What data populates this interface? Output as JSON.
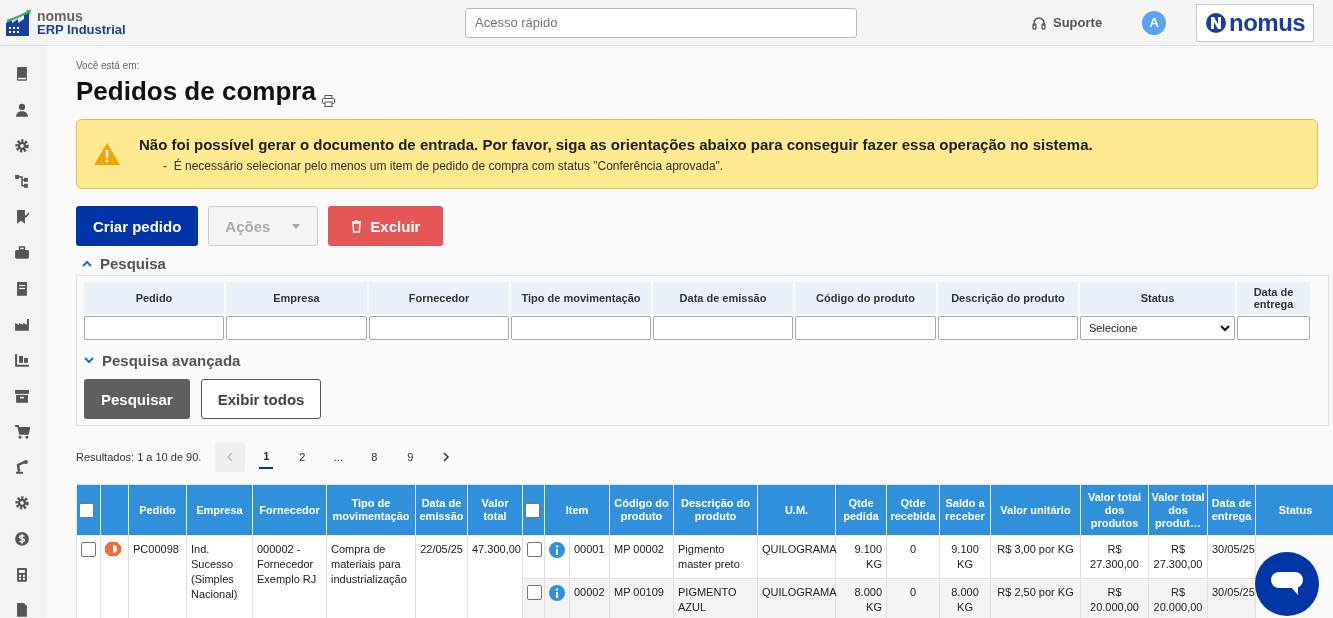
{
  "header": {
    "logo_line1": "nomus",
    "logo_line2": "ERP Industrial",
    "search": {
      "placeholder": "Acesso rápido"
    },
    "support": "Suporte",
    "avatar": "A",
    "brand": "nomus"
  },
  "breadcrumb": "Você está em:",
  "title": "Pedidos de compra",
  "alert": {
    "title": "Não foi possível gerar o documento de entrada. Por favor, siga as orientações abaixo para conseguir fazer essa operação no sistema.",
    "items": [
      {
        "bullet": "-",
        "text": "É necessário selecionar pelo menos um item de pedido de compra com status \"Conferência aprovada\"."
      }
    ]
  },
  "actions": [
    {
      "label": "Criar pedido",
      "kind": "primary",
      "disabled": false
    },
    {
      "label": "Ações",
      "kind": "dropdown",
      "disabled": true
    },
    {
      "label": "Excluir",
      "kind": "danger",
      "disabled": false
    }
  ],
  "search": {
    "title": "Pesquisa",
    "expanded": true,
    "fields": [
      {
        "label": "Pedido",
        "kind": "text"
      },
      {
        "label": "Empresa",
        "kind": "text"
      },
      {
        "label": "Fornecedor",
        "kind": "text"
      },
      {
        "label": "Tipo de movimentação",
        "kind": "text"
      },
      {
        "label": "Data de emissão",
        "kind": "text"
      },
      {
        "label": "Código do produto",
        "kind": "text"
      },
      {
        "label": "Descrição do produto",
        "kind": "text"
      },
      {
        "label": "Status",
        "kind": "select",
        "value": "Selecione"
      },
      {
        "label": "Data de entrega",
        "kind": "text"
      }
    ],
    "advanced": {
      "title": "Pesquisa avançada",
      "expanded": false
    },
    "buttons": [
      {
        "label": "Pesquisar",
        "kind": "primary"
      },
      {
        "label": "Exibir todos",
        "kind": "outline"
      }
    ]
  },
  "results": {
    "summary": "Resultados: 1 a 10 de 90.",
    "pages": [
      {
        "label": "1",
        "selected": true
      },
      {
        "label": "2",
        "selected": false
      },
      {
        "label": "...",
        "selected": false
      },
      {
        "label": "8",
        "selected": false
      },
      {
        "label": "9",
        "selected": false
      }
    ]
  },
  "table": {
    "all_orders_checked": false,
    "all_items_checked": false,
    "order_columns": [
      "Pedido",
      "Empresa",
      "Fornecedor",
      "Tipo de movimentação",
      "Data de emissão",
      "Valor total"
    ],
    "item_columns": [
      "Item",
      "Código do produto",
      "Descrição do produto",
      "U.M.",
      "Qtde pedida",
      "Qtde recebida",
      "Saldo a receber",
      "Valor unitário",
      "Valor total dos produtos",
      "Valor total dos produt…",
      "Data de entrega",
      "Status"
    ],
    "rows": [
      {
        "checked": false,
        "pedido": "PC00098",
        "empresa": "Ind. Sucesso (Simples Nacional)",
        "fornecedor": "000002 - Fornecedor Exemplo RJ",
        "tipo": "Compra de materiais para industrialização",
        "data_emissao": "22/05/25",
        "valor_total": "47.300,00",
        "items": [
          {
            "checked": false,
            "item": "00001",
            "codigo": "MP 00002",
            "descricao": "Pigmento master preto",
            "um": "QUILOGRAMA",
            "qtde_pedida": "9.100 KG",
            "qtde_recebida": "0",
            "saldo": "9.100 KG",
            "valor_unitario": "R$ 3,00 por KG",
            "valor_total_produtos": "R$ 27.300,00",
            "valor_total_2": "R$ 27.300,00",
            "data_entrega": "30/05/25"
          },
          {
            "checked": false,
            "item": "00002",
            "codigo": "MP 00109",
            "descricao": "PIGMENTO AZUL",
            "um": "QUILOGRAMA",
            "qtde_pedida": "8.000 KG",
            "qtde_recebida": "0",
            "saldo": "8.000 KG",
            "valor_unitario": "R$ 2,50 por KG",
            "valor_total_produtos": "R$ 20.000,00",
            "valor_total_2": "R$ 20.000,00",
            "data_entrega": "30/05/25"
          }
        ]
      }
    ]
  }
}
